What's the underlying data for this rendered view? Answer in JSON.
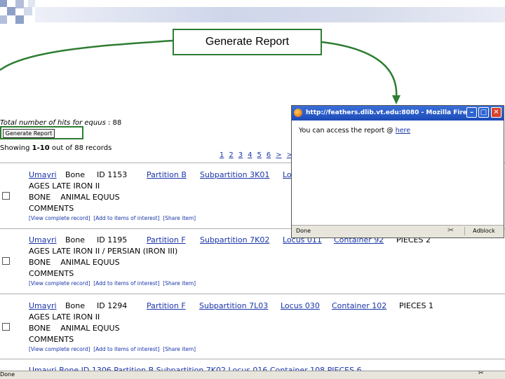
{
  "callout": {
    "label": "Generate Report"
  },
  "results": {
    "hits_label": "Total number of hits for",
    "hits_query": "equus",
    "hits_value": ": 88",
    "generate_button": "Generate Report",
    "showing_prefix": "Showing",
    "showing_range": "1-10",
    "showing_suffix": "out of 88 records",
    "pager": [
      "1",
      "2",
      "3",
      "4",
      "5",
      "6",
      ">",
      ">>"
    ],
    "records": [
      {
        "site": "Umayri",
        "type": "Bone",
        "id": "ID 1153",
        "partition": "Partition B",
        "subpartition": "Subpartition 3K01",
        "locus": "Locus",
        "container": "",
        "pieces": "",
        "period": "AGES LATE IRON II",
        "bone": "BONE",
        "animal_label": "ANIMAL",
        "animal": "EQUUS",
        "comments": "COMMENTS"
      },
      {
        "site": "Umayri",
        "type": "Bone",
        "id": "ID 1195",
        "partition": "Partition F",
        "subpartition": "Subpartition 7K02",
        "locus": "Locus 011",
        "container": "Container 92",
        "pieces": "PIECES 2",
        "period": "AGES LATE IRON II / PERSIAN (IRON III)",
        "bone": "BONE",
        "animal_label": "ANIMAL",
        "animal": "EQUUS",
        "comments": "COMMENTS"
      },
      {
        "site": "Umayri",
        "type": "Bone",
        "id": "ID 1294",
        "partition": "Partition F",
        "subpartition": "Subpartition 7L03",
        "locus": "Locus 030",
        "container": "Container 102",
        "pieces": "PIECES 1",
        "period": "AGES LATE IRON II",
        "bone": "BONE",
        "animal_label": "ANIMAL",
        "animal": "EQUUS",
        "comments": "COMMENTS"
      }
    ],
    "actions": [
      "[View complete record]",
      "[Add to items of interest]",
      "[Share item]"
    ],
    "cut_row": "Umayri  Bone  ID 1306  Partition B  Subpartition 7K02  Locus 016  Container 108  PIECES 6"
  },
  "popup": {
    "title": "http://feathers.dlib.vt.edu:8080 - Mozilla Fire...",
    "message": "You can access the report @",
    "link": "here",
    "status": "Done",
    "adblock": "Adblock"
  },
  "browser_status": "Done"
}
